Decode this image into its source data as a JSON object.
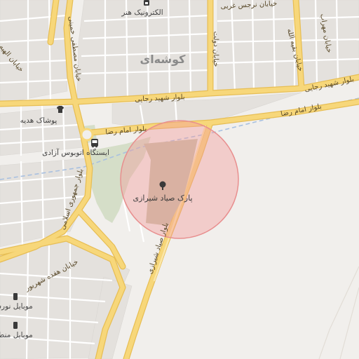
{
  "map": {
    "area_label": "کوشه‌ای",
    "colors": {
      "background": "#f1efec",
      "block": "#e4e1dd",
      "block_stroke": "#d9d6d2",
      "street": "#ffffff",
      "major_road": "#f7d77a",
      "major_road_edge": "#e7be55",
      "park": "#d5dec8",
      "park_area": "#c6c1a8",
      "railway": "#a8c0e0",
      "circle_fill": "rgba(244,155,155,0.42)",
      "circle_stroke": "#e88f8f"
    },
    "roads": {
      "rajaee": "بلوار شهید رجایی",
      "rajaee_east": "بلوار شهید رجایی",
      "imam_reza": "بلوار امام رضا",
      "imam_reza_east": "بلوار امام رضا",
      "mostafa_khomeini": "خیابان مصطفی خمینی",
      "jomhouri": "بلوار جمهوری اسلامی",
      "sayad": "بلوار صیاد شیرازی",
      "nargess": "خیابان نرجس غربی",
      "dolat": "خیابان دولت",
      "baqiyatallah": "خیابان بقیه الله",
      "mehrab": "خیابان مهراب",
      "hefdah_shahrivar": "خیابان هفده شهریور",
      "top_left": "خیابان الهیه"
    },
    "pois": {
      "electronics": "الکترونیک هنر",
      "gift_shop": "پوشاک هدیه",
      "bus_station": "ایستگاه اتوبوس آزادی",
      "park": "پارک صیاد شیرازی",
      "mobile_1": "موبایل نورس",
      "mobile_2": "موبایل منطق"
    },
    "icons": {
      "electronics": "store-icon",
      "gift_shop": "shirt-icon",
      "bus_station": "bus-icon",
      "park": "tree-icon",
      "mobile": "phone-icon"
    }
  }
}
